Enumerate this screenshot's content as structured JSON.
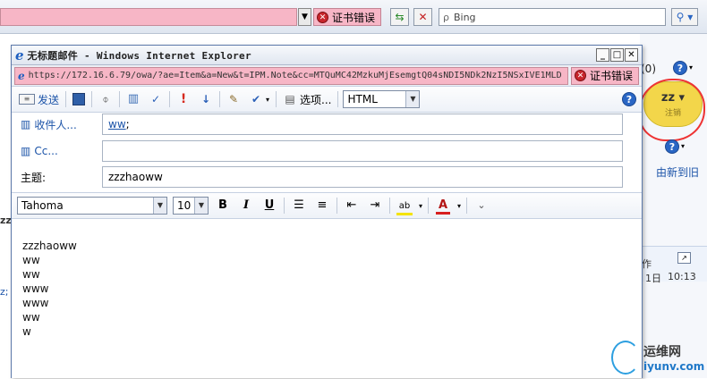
{
  "background": {
    "cert_error_label": "证书错误",
    "search_placeholder": "Bing",
    "counter": "(0)",
    "user_name": "zz",
    "user_sub": "注销",
    "sort_link": "由新到旧",
    "fragments": {
      "action": "作",
      "date": "1日",
      "time": "10:13",
      "left": [
        "zz",
        "z;"
      ]
    }
  },
  "popup": {
    "title": "无标题邮件 - Windows Internet Explorer",
    "url": "https://172.16.6.79/owa/?ae=Item&a=New&t=IPM.Note&cc=MTQuMC42MzkuMjEsemgtQ04sNDI5NDk2NzI5NSxIVE1MLD",
    "cert_error_label": "证书错误",
    "toolbar": {
      "send_label": "发送",
      "options_label": "选项...",
      "format_value": "HTML"
    },
    "fields": {
      "to_label": "收件人...",
      "to_value": "ww",
      "to_suffix": ";",
      "cc_label": "Cc...",
      "cc_value": "",
      "subject_label": "主题:",
      "subject_value": "zzzhaoww"
    },
    "format_bar": {
      "font": "Tahoma",
      "size": "10",
      "bold": "B",
      "italic": "I",
      "underline": "U"
    },
    "body_lines": [
      "zzzhaoww",
      "ww",
      "ww",
      "www",
      "www",
      "ww",
      "w"
    ]
  },
  "watermark": {
    "cn": "运维网",
    "en": "iyunv.com"
  },
  "colors": {
    "cert_error_bg": "#f7b6c6",
    "link_blue": "#1b53a8",
    "badge_yellow": "#f3d64a",
    "annotation_red": "#e33333"
  }
}
